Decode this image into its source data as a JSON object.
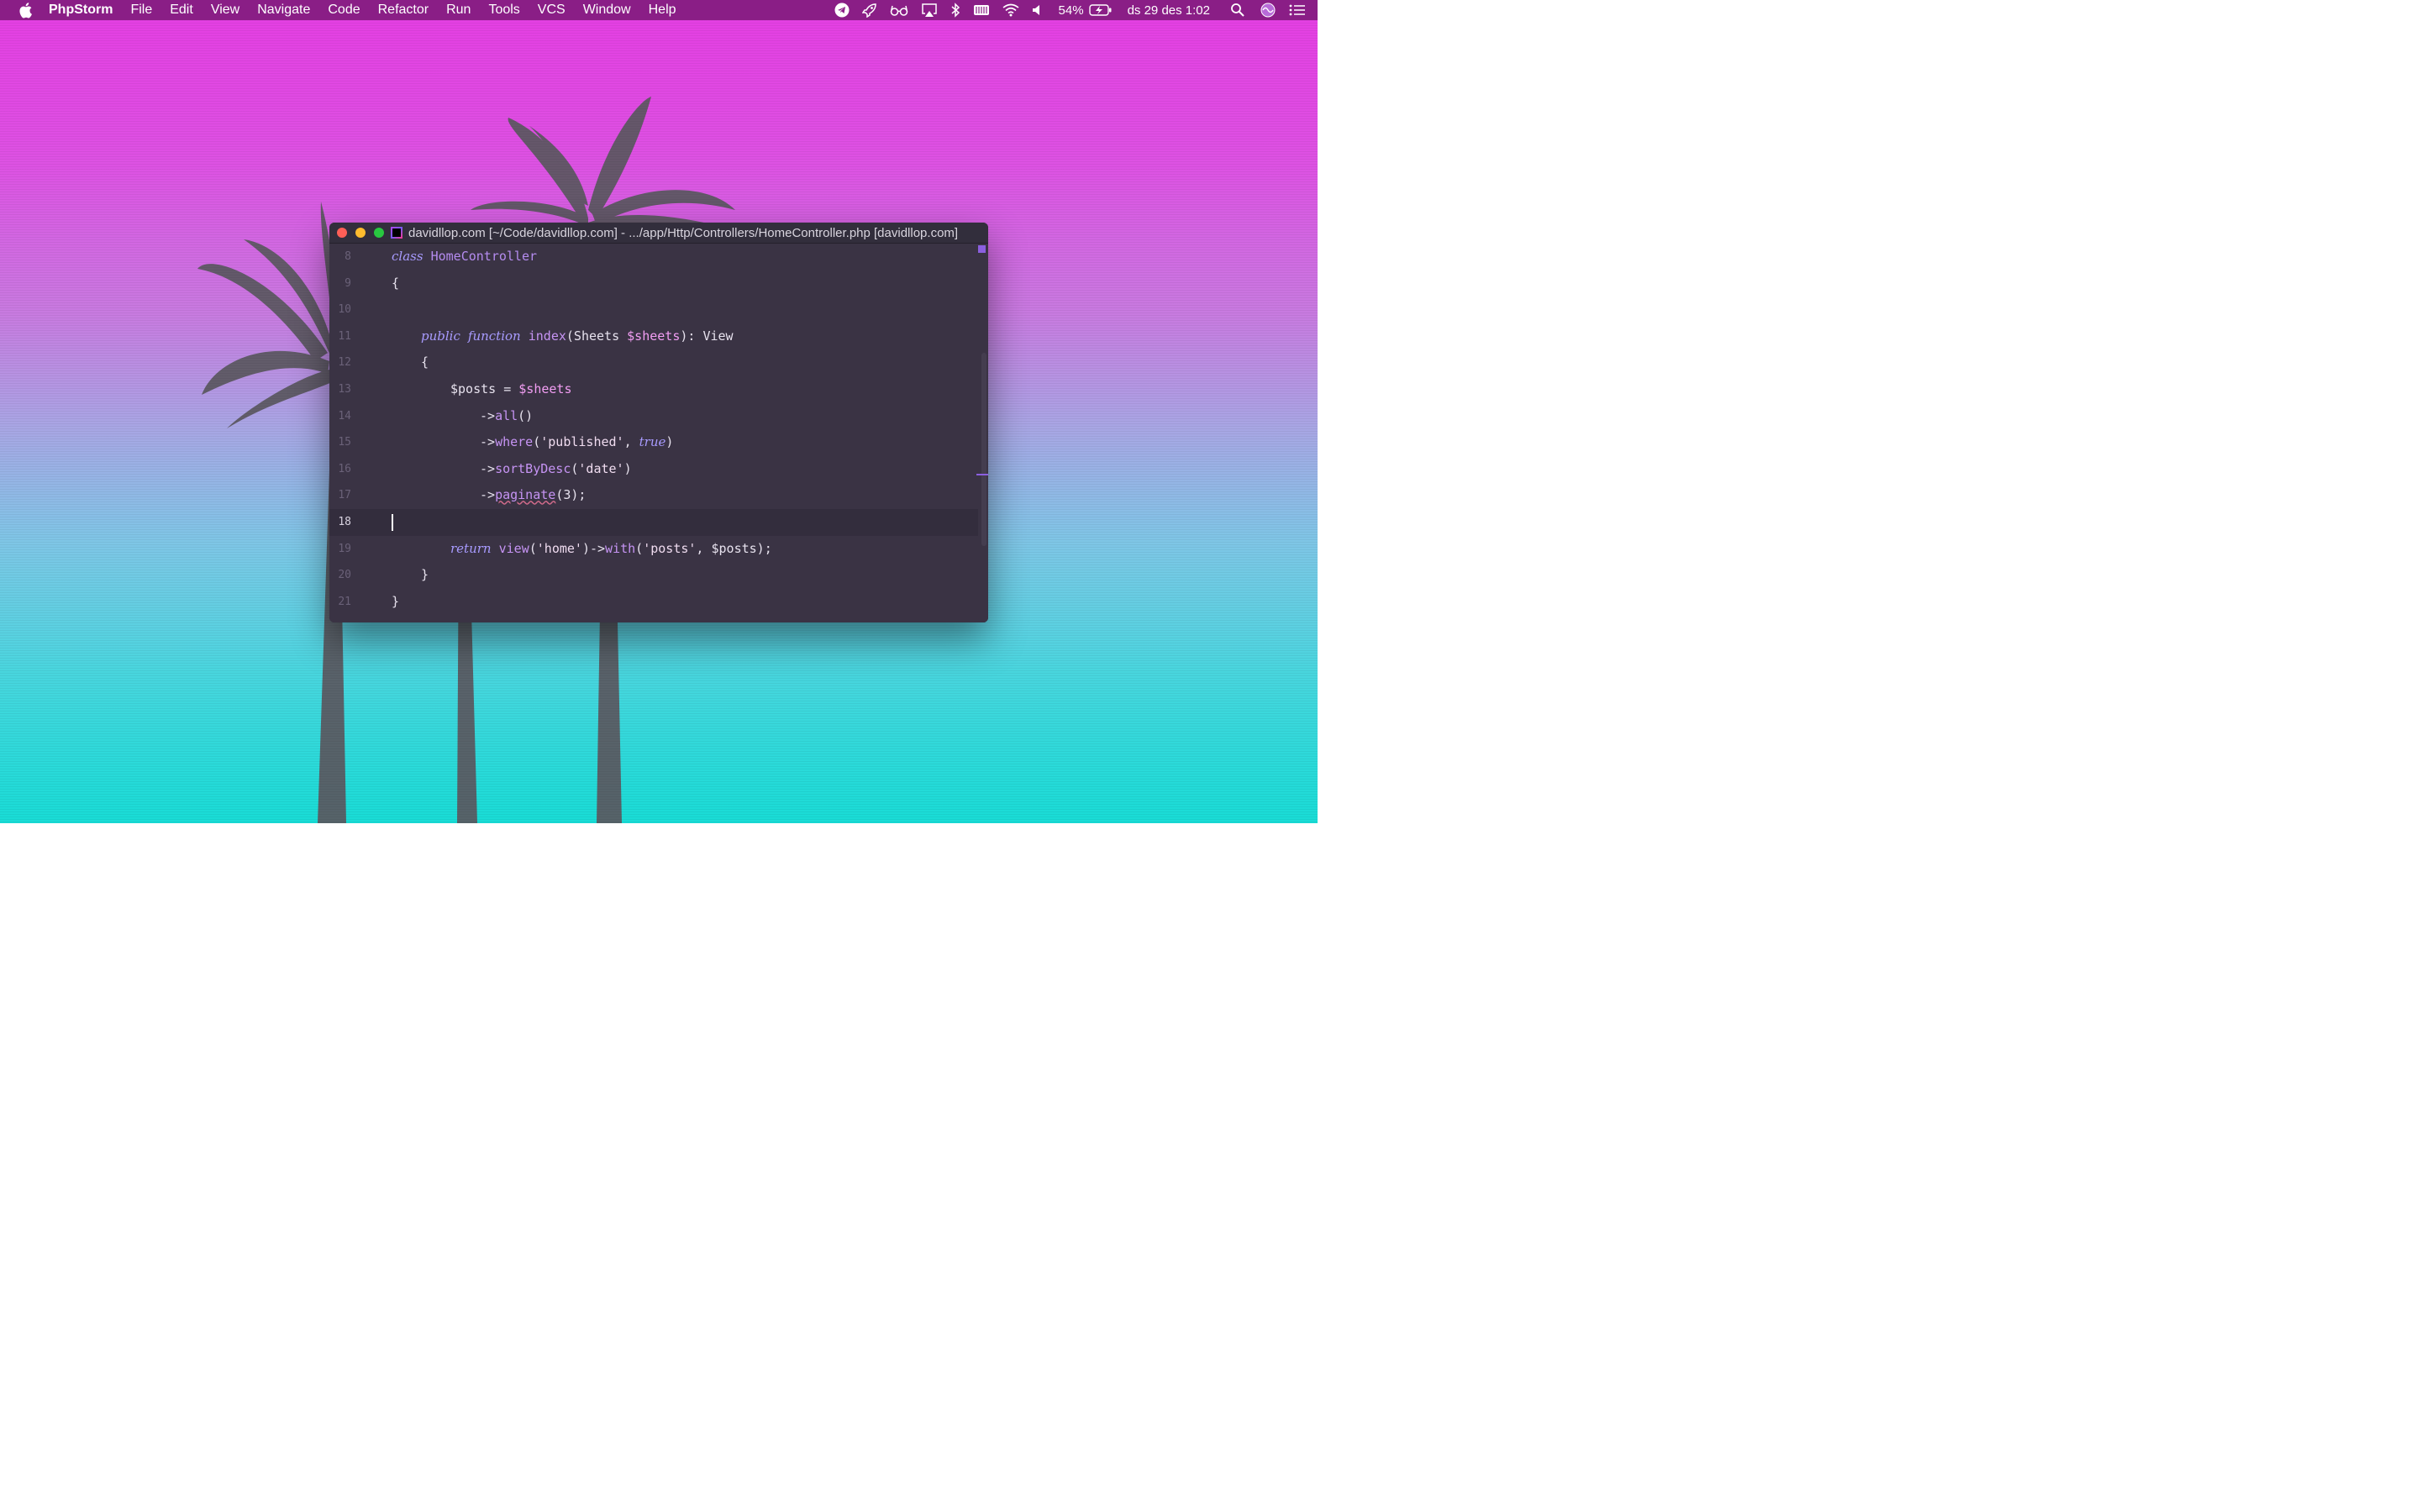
{
  "menubar": {
    "app_name": "PhpStorm",
    "items": [
      "File",
      "Edit",
      "View",
      "Navigate",
      "Code",
      "Refactor",
      "Run",
      "Tools",
      "VCS",
      "Window",
      "Help"
    ],
    "battery": "54%",
    "datetime": "ds 29 des  1:02",
    "icons": [
      "telegram-icon",
      "rocket-icon",
      "glasses-icon",
      "airplay-icon",
      "bluetooth-icon",
      "keyboard-icon",
      "wifi-icon",
      "volume-icon",
      "battery-icon",
      "search-icon",
      "siri-icon",
      "control-center-icon"
    ]
  },
  "window": {
    "title": "davidllop.com [~/Code/davidllop.com] - .../app/Http/Controllers/HomeController.php [davidllop.com]",
    "current_line": 18,
    "lines": [
      {
        "n": "8"
      },
      {
        "n": "9"
      },
      {
        "n": "10"
      },
      {
        "n": "11"
      },
      {
        "n": "12"
      },
      {
        "n": "13"
      },
      {
        "n": "14"
      },
      {
        "n": "15"
      },
      {
        "n": "16"
      },
      {
        "n": "17"
      },
      {
        "n": "18"
      },
      {
        "n": "19"
      },
      {
        "n": "20"
      },
      {
        "n": "21"
      }
    ],
    "code": {
      "l8_kw": "class",
      "l8_cls": "HomeController",
      "l9": "{",
      "l11_kw1": "public",
      "l11_kw2": "function",
      "l11_fn": "index",
      "l11_open": "(",
      "l11_type": "Sheets",
      "l11_var": "$sheets",
      "l11_rest": "): View",
      "l12": "{",
      "l13_var1": "$posts",
      "l13_eq": " = ",
      "l13_var2": "$sheets",
      "l14_arrow": "->",
      "l14_fn": "all",
      "l14_rest": "()",
      "l15_arrow": "->",
      "l15_fn": "where",
      "l15_open": "(",
      "l15_str": "'published'",
      "l15_comma": ", ",
      "l15_kw": "true",
      "l15_close": ")",
      "l16_arrow": "->",
      "l16_fn": "sortByDesc",
      "l16_open": "(",
      "l16_str": "'date'",
      "l16_close": ")",
      "l17_arrow": "->",
      "l17_fn": "paginate",
      "l17_rest": "(3);",
      "l19_kw": "return",
      "l19_fn1": "view",
      "l19_open1": "(",
      "l19_str1": "'home'",
      "l19_mid": ")->",
      "l19_fn2": "with",
      "l19_open2": "(",
      "l19_str2": "'posts'",
      "l19_comma": ", ",
      "l19_var": "$posts",
      "l19_close": ");",
      "l20": "}",
      "l21": "}"
    }
  }
}
